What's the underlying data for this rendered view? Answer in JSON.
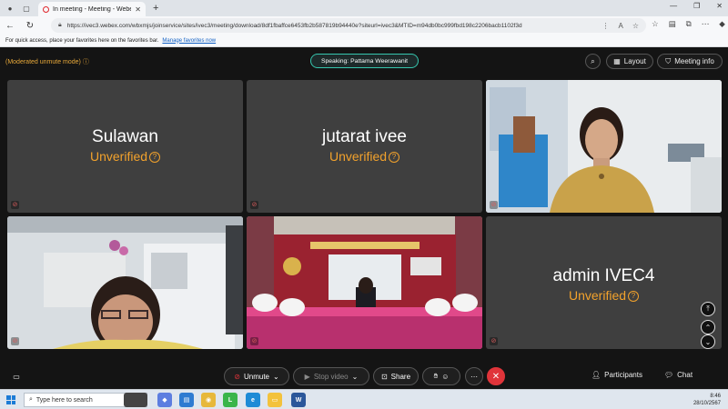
{
  "browser": {
    "tab_title": "In meeting - Meeting - Webex",
    "url": "https://ivec3.webex.com/wbxmjs/joinservice/sites/ivec3/meeting/download/8df1fbaffce6453fb2b587819b94440e?siteurl=ivec3&MTID=m94db0bc999fbd198c2206bacb1102f3d",
    "favorites_message": "For quick access, place your favorites here on the favorites bar.",
    "favorites_link": "Manage favorites now"
  },
  "meeting": {
    "moderated_label": "(Moderated unmute mode)",
    "speaking_label": "Speaking: Pattama Weerawanit",
    "layout_label": "Layout",
    "meeting_info_label": "Meeting info",
    "unverified_label": "Unverified",
    "participants": [
      {
        "name": "Sulawan"
      },
      {
        "name": "jutarat ivee"
      },
      {
        "name": "admin IVEC4"
      }
    ]
  },
  "controls": {
    "unmute_label": "Unmute",
    "stop_video_label": "Stop video",
    "share_label": "Share",
    "participants_label": "Participants",
    "chat_label": "Chat"
  },
  "taskbar": {
    "search_placeholder": "Type here to search",
    "time": "8:46",
    "date": "28/10/2567"
  },
  "colors": {
    "accent_speaking": "#36c6ae",
    "unverified": "#f2a22c",
    "leave": "#e0343a"
  }
}
